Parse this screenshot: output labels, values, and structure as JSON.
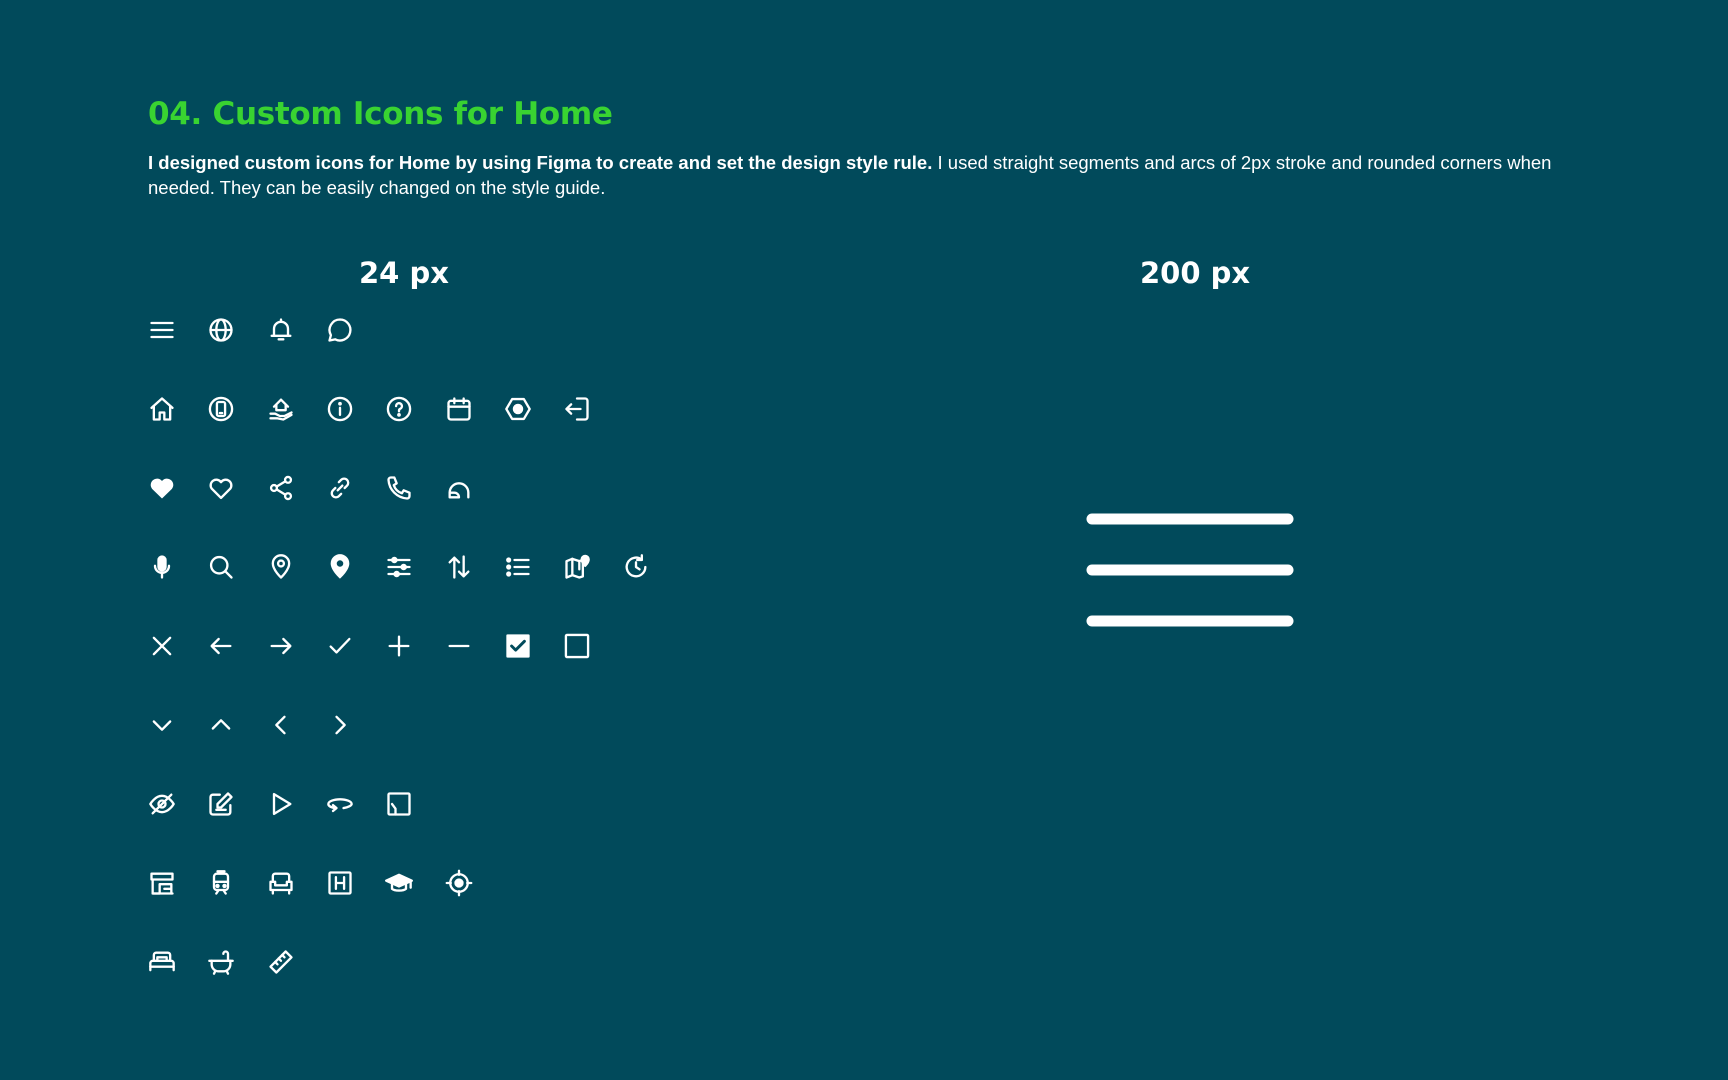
{
  "header": {
    "title": "04. Custom Icons for Home",
    "description_bold": "I designed custom icons for Home by using Figma to create and set the design style rule.",
    "description_rest": " I used straight segments and arcs of 2px stroke and rounded corners when needed. They can be easily changed on the style guide."
  },
  "small_section": {
    "label": "24 px"
  },
  "large_section": {
    "label": "200 px",
    "icon": "menu-icon"
  },
  "colors": {
    "background": "#014a5b",
    "accent": "#39d331",
    "icon": "#ffffff"
  },
  "icons": [
    [
      "menu-icon",
      "globe-icon",
      "bell-icon",
      "chat-bubble-icon"
    ],
    [
      "home-icon",
      "mobile-device-icon",
      "home-hand-icon",
      "info-icon",
      "help-icon",
      "calendar-icon",
      "settings-hexagon-icon",
      "logout-icon"
    ],
    [
      "heart-filled-icon",
      "heart-outline-icon",
      "share-icon",
      "link-icon",
      "phone-icon",
      "headset-icon"
    ],
    [
      "microphone-icon",
      "search-icon",
      "location-pin-outline-icon",
      "location-pin-filled-icon",
      "sliders-icon",
      "sort-arrows-icon",
      "list-icon",
      "map-pin-icon",
      "history-icon"
    ],
    [
      "close-icon",
      "arrow-left-icon",
      "arrow-right-icon",
      "check-icon",
      "plus-icon",
      "minus-icon",
      "checkbox-checked-icon",
      "checkbox-empty-icon"
    ],
    [
      "chevron-down-icon",
      "chevron-up-icon",
      "chevron-left-icon",
      "chevron-right-icon"
    ],
    [
      "eye-off-icon",
      "edit-icon",
      "play-icon",
      "rotate-360-icon",
      "floor-plan-icon"
    ],
    [
      "store-icon",
      "train-icon",
      "sofa-icon",
      "hospital-icon",
      "education-icon",
      "target-icon"
    ],
    [
      "bed-icon",
      "bathtub-icon",
      "ruler-icon"
    ]
  ]
}
